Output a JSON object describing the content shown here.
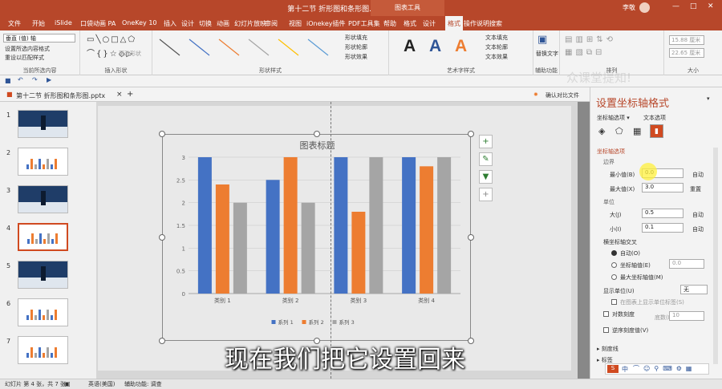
{
  "window": {
    "title": "第十二节 折形图和条形图.pptx - PowerPoint",
    "context_group": "图表工具",
    "user": "李敬",
    "min": "—",
    "restore": "□",
    "close": "✕"
  },
  "ribbon_tabs": [
    "文件",
    "开始",
    "iSlide",
    "口袋动画 PA",
    "OneKey 10",
    "插入",
    "设计",
    "切换",
    "动画",
    "幻灯片放映",
    "审阅",
    "视图",
    "iOnekey插件",
    "PDF工具集",
    "帮助",
    "格式",
    "设计",
    "格式",
    "操作说明搜索"
  ],
  "active_tab_index": 17,
  "ribbon": {
    "selection_dropdown": "垂直 (值) 轴",
    "fmt_selection": "设置所选内容格式",
    "reset_style": "重设以匹配样式",
    "group_current": "当前所选内容",
    "group_insert_shapes": "插入形状",
    "change_shape": "更改形状",
    "group_shape_styles": "形状样式",
    "shape_fill": "形状填充",
    "shape_outline": "形状轮廓",
    "shape_effects": "形状效果",
    "art_letters": [
      "A",
      "A",
      "A"
    ],
    "art_colors": [
      "#000000",
      "#2f5597",
      "#ed7d31"
    ],
    "text_fill": "文本填充",
    "text_outline": "文本轮廓",
    "text_effects": "文本效果",
    "group_art": "艺术字样式",
    "alt_text": "替换文字",
    "group_access": "辅助功能",
    "group_arrange": "排列",
    "size_h": "15.88 厘米",
    "size_w": "22.65 厘米",
    "group_size": "大小"
  },
  "qat": [
    "save",
    "undo",
    "redo",
    "start"
  ],
  "doc_tab": {
    "name": "第十二节 折形图和条形图.pptx",
    "close": "×",
    "add": "+",
    "right": "确认对比文件"
  },
  "thumbnails": [
    {
      "num": "1",
      "style": "dark"
    },
    {
      "num": "2",
      "style": "light"
    },
    {
      "num": "3",
      "style": "dark"
    },
    {
      "num": "4",
      "style": "light",
      "selected": true
    },
    {
      "num": "5",
      "style": "dark"
    },
    {
      "num": "6",
      "style": "light"
    },
    {
      "num": "7",
      "style": "light"
    }
  ],
  "chart_data": {
    "type": "bar",
    "title": "图表标题",
    "categories": [
      "类别 1",
      "类别 2",
      "类别 3",
      "类别 4"
    ],
    "series": [
      {
        "name": "系列 1",
        "values": [
          3.0,
          2.5,
          3.0,
          3.0
        ],
        "color": "#4472c4"
      },
      {
        "name": "系列 2",
        "values": [
          2.4,
          3.0,
          1.8,
          2.8
        ],
        "color": "#ed7d31"
      },
      {
        "name": "系列 3",
        "values": [
          2.0,
          2.0,
          3.0,
          3.0
        ],
        "color": "#a5a5a5"
      }
    ],
    "ylim": [
      0,
      3
    ],
    "yticks": [
      "0",
      "0.5",
      "1",
      "1.5",
      "2",
      "2.5",
      "3"
    ],
    "grid": true,
    "legend": "bottom"
  },
  "chart_buttons": [
    "+",
    "✎",
    "▼",
    "+"
  ],
  "subtitle": "现在我们把它设置回来",
  "pane": {
    "title": "设置坐标轴格式",
    "tab1": "坐标轴选项 ▾",
    "tab2": "文本选项",
    "section": "坐标轴选项",
    "bounds": "边界",
    "min_label": "最小值(B)",
    "min_value": "0.0",
    "auto1": "自动",
    "max_label": "最大值(X)",
    "max_value": "3.0",
    "reset": "重置",
    "units": "单位",
    "major_label": "大(J)",
    "major_value": "0.5",
    "auto2": "自动",
    "minor_label": "小(I)",
    "minor_value": "0.1",
    "auto3": "自动",
    "cross_label": "横坐标轴交叉",
    "cross_auto": "自动(O)",
    "cross_value_label": "坐标轴值(E)",
    "cross_value": "0.0",
    "cross_max": "最大坐标轴值(M)",
    "display_units_label": "显示单位(U)",
    "display_units_value": "无",
    "show_unit_label": "在图表上显示单位标签(S)",
    "log_scale": "对数刻度",
    "log_base_label": "底数(B)",
    "log_base_value": "10",
    "reverse": "逆序刻度值(V)",
    "tick_marks": "刻度线",
    "labels": "标签"
  },
  "status": {
    "slide": "幻灯片 第 4 张，共 7 张",
    "lang": "英语(美国)",
    "access": "辅助功能: 调查"
  },
  "ime": "中",
  "watermark": "众课堂提知!"
}
